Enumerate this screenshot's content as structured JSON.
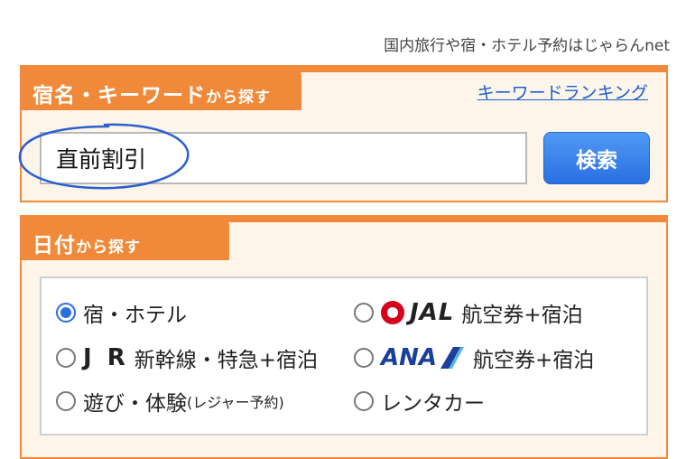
{
  "tagline": "国内旅行や宿・ホテル予約はじゃらんnet",
  "keyword_panel": {
    "tab_main": "宿名・キーワード",
    "tab_small": "から探す",
    "ranking_link": "キーワードランキング",
    "search_value": "直前割引",
    "search_button": "検索"
  },
  "date_panel": {
    "tab_main": "日付",
    "tab_small": "から探す",
    "options": [
      {
        "label": "宿・ホテル",
        "checked": true
      },
      {
        "logo": "JAL",
        "label": "航空券+宿泊",
        "checked": false
      },
      {
        "logo": "J R",
        "label": "新幹線・特急+宿泊",
        "checked": false
      },
      {
        "logo": "ANA",
        "label": "航空券+宿泊",
        "checked": false
      },
      {
        "label": "遊び・体験",
        "note": "(レジャー予約)",
        "checked": false
      },
      {
        "label": "レンタカー",
        "checked": false
      }
    ]
  },
  "colors": {
    "accent": "#f08a3a",
    "button": "#2a6fe2",
    "link": "#1a5fd0",
    "annotation": "#2a5fd0"
  }
}
